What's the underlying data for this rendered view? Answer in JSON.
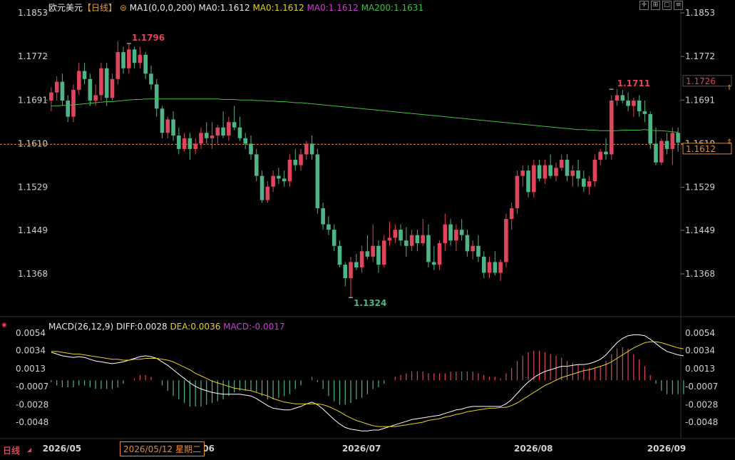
{
  "header": {
    "symbol": "欧元美元",
    "period": "【日线】",
    "ma1_label": "MA1(0,0,0,200)",
    "ma0_white": "MA0:1.1612",
    "ma0_yellow": "MA0:1.1612",
    "ma0_magenta": "MA0:1.1612",
    "ma200": "MA200:1.1631"
  },
  "macd_header": {
    "title": "MACD(26,12,9)",
    "diff": "DIFF:0.0028",
    "dea": "DEA:0.0036",
    "macd": "MACD:-0.0017"
  },
  "colors": {
    "up": "#e0455c",
    "down": "#4fb487",
    "ma200": "#3fbf3f",
    "diff": "#ffffff",
    "dea": "#e6d21e",
    "macd_label": "#c93fd0",
    "price_line": "#e08a3a",
    "grid": "#2a2a2a"
  },
  "bottom_bar": {
    "period_tab": "日线",
    "date_box": "2026/05/12 星期二"
  },
  "chart_data": [
    {
      "type": "candlestick",
      "title": "欧元美元",
      "y_ticks": [
        "1.1853",
        "1.1772",
        "1.1691",
        "1.1610",
        "1.1529",
        "1.1449",
        "1.1368"
      ],
      "ylim": [
        1.1287,
        1.1853
      ],
      "x_ticks": [
        "2026/05",
        "2026/06",
        "2026/07",
        "2026/08",
        "2026/09"
      ],
      "annotations": {
        "high": "1.1796",
        "low": "1.1324",
        "recent_high": "1.1711"
      },
      "last_price": "1.1612",
      "right_box_price": "1.1726",
      "right_edge_label": "1.1610",
      "grid": false,
      "candles": [
        [
          1.169,
          1.1715,
          1.167,
          1.1705
        ],
        [
          1.1705,
          1.1735,
          1.169,
          1.1725
        ],
        [
          1.1725,
          1.174,
          1.168,
          1.169
        ],
        [
          1.169,
          1.17,
          1.165,
          1.166
        ],
        [
          1.166,
          1.172,
          1.165,
          1.171
        ],
        [
          1.171,
          1.176,
          1.17,
          1.1745
        ],
        [
          1.1745,
          1.176,
          1.172,
          1.173
        ],
        [
          1.173,
          1.174,
          1.168,
          1.169
        ],
        [
          1.169,
          1.172,
          1.168,
          1.17
        ],
        [
          1.17,
          1.176,
          1.169,
          1.175
        ],
        [
          1.175,
          1.176,
          1.168,
          1.1695
        ],
        [
          1.1695,
          1.174,
          1.169,
          1.173
        ],
        [
          1.173,
          1.18,
          1.172,
          1.178
        ],
        [
          1.178,
          1.179,
          1.174,
          1.175
        ],
        [
          1.175,
          1.1796,
          1.174,
          1.1785
        ],
        [
          1.1785,
          1.179,
          1.175,
          1.176
        ],
        [
          1.176,
          1.179,
          1.175,
          1.1775
        ],
        [
          1.1775,
          1.178,
          1.173,
          1.174
        ],
        [
          1.174,
          1.1755,
          1.171,
          1.172
        ],
        [
          1.172,
          1.173,
          1.166,
          1.1675
        ],
        [
          1.1675,
          1.168,
          1.162,
          1.163
        ],
        [
          1.163,
          1.166,
          1.162,
          1.1655
        ],
        [
          1.1655,
          1.167,
          1.1615,
          1.1625
        ],
        [
          1.1625,
          1.164,
          1.159,
          1.16
        ],
        [
          1.16,
          1.163,
          1.1595,
          1.162
        ],
        [
          1.162,
          1.163,
          1.158,
          1.16
        ],
        [
          1.16,
          1.162,
          1.159,
          1.161
        ],
        [
          1.161,
          1.164,
          1.16,
          1.163
        ],
        [
          1.163,
          1.165,
          1.161,
          1.162
        ],
        [
          1.162,
          1.165,
          1.16,
          1.1625
        ],
        [
          1.1625,
          1.1645,
          1.161,
          1.164
        ],
        [
          1.164,
          1.167,
          1.162,
          1.1625
        ],
        [
          1.1625,
          1.166,
          1.1615,
          1.165
        ],
        [
          1.165,
          1.168,
          1.1635,
          1.164
        ],
        [
          1.164,
          1.166,
          1.1615,
          1.162
        ],
        [
          1.162,
          1.163,
          1.16,
          1.161
        ],
        [
          1.161,
          1.1625,
          1.158,
          1.159
        ],
        [
          1.159,
          1.16,
          1.154,
          1.155
        ],
        [
          1.155,
          1.156,
          1.15,
          1.1505
        ],
        [
          1.1505,
          1.154,
          1.15,
          1.153
        ],
        [
          1.153,
          1.156,
          1.152,
          1.155
        ],
        [
          1.155,
          1.1565,
          1.1535,
          1.1545
        ],
        [
          1.1545,
          1.156,
          1.153,
          1.154
        ],
        [
          1.154,
          1.159,
          1.153,
          1.158
        ],
        [
          1.158,
          1.16,
          1.156,
          1.157
        ],
        [
          1.157,
          1.16,
          1.156,
          1.159
        ],
        [
          1.159,
          1.1615,
          1.158,
          1.161
        ],
        [
          1.161,
          1.1625,
          1.158,
          1.159
        ],
        [
          1.159,
          1.16,
          1.148,
          1.149
        ],
        [
          1.149,
          1.15,
          1.145,
          1.146
        ],
        [
          1.146,
          1.1475,
          1.144,
          1.145
        ],
        [
          1.145,
          1.146,
          1.141,
          1.142
        ],
        [
          1.142,
          1.143,
          1.138,
          1.1385
        ],
        [
          1.1385,
          1.139,
          1.1345,
          1.136
        ],
        [
          1.136,
          1.14,
          1.1324,
          1.139
        ],
        [
          1.139,
          1.1405,
          1.1375,
          1.138
        ],
        [
          1.138,
          1.142,
          1.137,
          1.141
        ],
        [
          1.141,
          1.144,
          1.1395,
          1.14
        ],
        [
          1.14,
          1.146,
          1.139,
          1.142
        ],
        [
          1.142,
          1.143,
          1.137,
          1.1385
        ],
        [
          1.1385,
          1.144,
          1.138,
          1.143
        ],
        [
          1.143,
          1.1465,
          1.142,
          1.1435
        ],
        [
          1.1435,
          1.146,
          1.1425,
          1.145
        ],
        [
          1.145,
          1.146,
          1.142,
          1.143
        ],
        [
          1.143,
          1.1455,
          1.14,
          1.142
        ],
        [
          1.142,
          1.145,
          1.141,
          1.144
        ],
        [
          1.144,
          1.145,
          1.141,
          1.1425
        ],
        [
          1.1425,
          1.147,
          1.142,
          1.144
        ],
        [
          1.144,
          1.146,
          1.138,
          1.139
        ],
        [
          1.139,
          1.142,
          1.1375,
          1.1385
        ],
        [
          1.1385,
          1.143,
          1.1375,
          1.1425
        ],
        [
          1.1425,
          1.148,
          1.141,
          1.146
        ],
        [
          1.146,
          1.147,
          1.142,
          1.143
        ],
        [
          1.143,
          1.146,
          1.141,
          1.145
        ],
        [
          1.145,
          1.147,
          1.143,
          1.144
        ],
        [
          1.144,
          1.145,
          1.14,
          1.141
        ],
        [
          1.141,
          1.143,
          1.1395,
          1.142
        ],
        [
          1.142,
          1.144,
          1.139,
          1.14
        ],
        [
          1.14,
          1.141,
          1.136,
          1.137
        ],
        [
          1.137,
          1.14,
          1.136,
          1.139
        ],
        [
          1.139,
          1.141,
          1.1365,
          1.137
        ],
        [
          1.137,
          1.1395,
          1.1355,
          1.139
        ],
        [
          1.139,
          1.148,
          1.138,
          1.147
        ],
        [
          1.147,
          1.15,
          1.145,
          1.149
        ],
        [
          1.149,
          1.156,
          1.148,
          1.155
        ],
        [
          1.155,
          1.157,
          1.153,
          1.156
        ],
        [
          1.156,
          1.157,
          1.151,
          1.152
        ],
        [
          1.152,
          1.158,
          1.151,
          1.157
        ],
        [
          1.157,
          1.158,
          1.154,
          1.1545
        ],
        [
          1.1545,
          1.158,
          1.1535,
          1.157
        ],
        [
          1.157,
          1.159,
          1.1545,
          1.155
        ],
        [
          1.155,
          1.1575,
          1.154,
          1.1565
        ],
        [
          1.1565,
          1.159,
          1.156,
          1.158
        ],
        [
          1.158,
          1.159,
          1.154,
          1.155
        ],
        [
          1.155,
          1.157,
          1.153,
          1.156
        ],
        [
          1.156,
          1.158,
          1.153,
          1.1545
        ],
        [
          1.1545,
          1.156,
          1.152,
          1.153
        ],
        [
          1.153,
          1.155,
          1.1515,
          1.154
        ],
        [
          1.154,
          1.159,
          1.153,
          1.158
        ],
        [
          1.158,
          1.16,
          1.157,
          1.1595
        ],
        [
          1.1595,
          1.162,
          1.158,
          1.159
        ],
        [
          1.159,
          1.17,
          1.158,
          1.169
        ],
        [
          1.169,
          1.1711,
          1.168,
          1.17
        ],
        [
          1.17,
          1.171,
          1.1685,
          1.169
        ],
        [
          1.169,
          1.1705,
          1.167,
          1.168
        ],
        [
          1.168,
          1.1695,
          1.166,
          1.169
        ],
        [
          1.169,
          1.17,
          1.166,
          1.167
        ],
        [
          1.167,
          1.169,
          1.165,
          1.1665
        ],
        [
          1.1665,
          1.167,
          1.16,
          1.161
        ],
        [
          1.161,
          1.164,
          1.157,
          1.1575
        ],
        [
          1.1575,
          1.162,
          1.157,
          1.1615
        ],
        [
          1.1615,
          1.163,
          1.159,
          1.16
        ],
        [
          1.16,
          1.164,
          1.157,
          1.163
        ],
        [
          1.163,
          1.164,
          1.1595,
          1.1612
        ]
      ],
      "ma200": [
        1.168,
        1.168,
        1.1681,
        1.1681,
        1.1682,
        1.1683,
        1.1684,
        1.1685,
        1.1686,
        1.1687,
        1.1688,
        1.1688,
        1.1689,
        1.169,
        1.1691,
        1.1692,
        1.1692,
        1.1693,
        1.1693,
        1.1693,
        1.1693,
        1.1693,
        1.1693,
        1.1693,
        1.1693,
        1.1693,
        1.1693,
        1.1693,
        1.1693,
        1.1693,
        1.1693,
        1.1692,
        1.1692,
        1.1692,
        1.1691,
        1.1691,
        1.1691,
        1.169,
        1.169,
        1.1689,
        1.1689,
        1.1688,
        1.1688,
        1.1687,
        1.1686,
        1.1686,
        1.1685,
        1.1684,
        1.1683,
        1.1682,
        1.1681,
        1.168,
        1.1679,
        1.1678,
        1.1677,
        1.1676,
        1.1675,
        1.1674,
        1.1673,
        1.1672,
        1.1671,
        1.167,
        1.1669,
        1.1668,
        1.1667,
        1.1666,
        1.1665,
        1.1664,
        1.1663,
        1.1662,
        1.1661,
        1.166,
        1.1659,
        1.1658,
        1.1657,
        1.1656,
        1.1655,
        1.1654,
        1.1653,
        1.1652,
        1.1651,
        1.165,
        1.1649,
        1.1648,
        1.1647,
        1.1646,
        1.1645,
        1.1644,
        1.1643,
        1.1642,
        1.1641,
        1.164,
        1.1639,
        1.1638,
        1.1637,
        1.1636,
        1.1636,
        1.1635,
        1.1635,
        1.1634,
        1.1634,
        1.1634,
        1.1634,
        1.1635,
        1.1635,
        1.1635,
        1.1635,
        1.1636,
        1.1635,
        1.1634,
        1.1634,
        1.1633,
        1.1632,
        1.1631
      ]
    },
    {
      "type": "line",
      "title": "MACD(26,12,9)",
      "y_ticks": [
        "0.0054",
        "0.0034",
        "0.0013",
        "-0.0007",
        "-0.0028",
        "-0.0048"
      ],
      "ylim": [
        -0.0064,
        0.0066
      ],
      "series": [
        {
          "name": "DIFF",
          "values": [
            0.0032,
            0.003,
            0.0028,
            0.0027,
            0.0026,
            0.0027,
            0.0026,
            0.0024,
            0.0022,
            0.0021,
            0.002,
            0.0019,
            0.002,
            0.0021,
            0.0023,
            0.0025,
            0.0027,
            0.0028,
            0.0027,
            0.0025,
            0.0021,
            0.0017,
            0.0012,
            0.0007,
            0.0002,
            -0.0003,
            -0.0007,
            -0.001,
            -0.0012,
            -0.0014,
            -0.0015,
            -0.0016,
            -0.0016,
            -0.0016,
            -0.0016,
            -0.0017,
            -0.0018,
            -0.0021,
            -0.0025,
            -0.0029,
            -0.0032,
            -0.0033,
            -0.0034,
            -0.0034,
            -0.0032,
            -0.003,
            -0.0027,
            -0.0025,
            -0.0028,
            -0.0033,
            -0.0039,
            -0.0045,
            -0.005,
            -0.0054,
            -0.0056,
            -0.0057,
            -0.0058,
            -0.0058,
            -0.0057,
            -0.0057,
            -0.0055,
            -0.0053,
            -0.0051,
            -0.0049,
            -0.0047,
            -0.0045,
            -0.0044,
            -0.0043,
            -0.0042,
            -0.0041,
            -0.004,
            -0.0038,
            -0.0036,
            -0.0034,
            -0.0033,
            -0.0031,
            -0.003,
            -0.003,
            -0.003,
            -0.003,
            -0.003,
            -0.003,
            -0.0027,
            -0.0022,
            -0.0015,
            -0.0008,
            -0.0002,
            0.0003,
            0.0007,
            0.001,
            0.0012,
            0.0014,
            0.0016,
            0.0016,
            0.0017,
            0.0018,
            0.0018,
            0.0019,
            0.0021,
            0.0024,
            0.0029,
            0.0036,
            0.0043,
            0.0048,
            0.0051,
            0.0052,
            0.0052,
            0.0051,
            0.0047,
            0.0042,
            0.0037,
            0.0033,
            0.0031,
            0.0029,
            0.0028
          ]
        },
        {
          "name": "DEA",
          "values": [
            0.0033,
            0.0033,
            0.0032,
            0.0031,
            0.003,
            0.003,
            0.0029,
            0.0028,
            0.0027,
            0.0026,
            0.0025,
            0.0024,
            0.0024,
            0.0023,
            0.0023,
            0.0024,
            0.0024,
            0.0025,
            0.0025,
            0.0025,
            0.0024,
            0.0023,
            0.0021,
            0.0018,
            0.0015,
            0.0012,
            0.0008,
            0.0005,
            0.0002,
            -0.0001,
            -0.0003,
            -0.0005,
            -0.0007,
            -0.0009,
            -0.001,
            -0.0011,
            -0.0012,
            -0.0014,
            -0.0016,
            -0.0018,
            -0.0021,
            -0.0023,
            -0.0025,
            -0.0026,
            -0.0027,
            -0.0027,
            -0.0027,
            -0.0027,
            -0.0027,
            -0.0028,
            -0.003,
            -0.0033,
            -0.0036,
            -0.004,
            -0.0043,
            -0.0046,
            -0.0048,
            -0.005,
            -0.0052,
            -0.0053,
            -0.0053,
            -0.0053,
            -0.0053,
            -0.0052,
            -0.0051,
            -0.005,
            -0.0049,
            -0.0048,
            -0.0046,
            -0.0045,
            -0.0044,
            -0.0042,
            -0.0041,
            -0.0039,
            -0.0038,
            -0.0036,
            -0.0035,
            -0.0034,
            -0.0033,
            -0.0032,
            -0.0032,
            -0.0031,
            -0.0031,
            -0.0029,
            -0.0026,
            -0.0022,
            -0.0018,
            -0.0014,
            -0.001,
            -0.0006,
            -0.0003,
            0.0,
            0.0003,
            0.0005,
            0.0007,
            0.0009,
            0.0011,
            0.0012,
            0.0014,
            0.0016,
            0.0018,
            0.0021,
            0.0025,
            0.0029,
            0.0033,
            0.0037,
            0.004,
            0.0043,
            0.0044,
            0.0044,
            0.0043,
            0.0041,
            0.0039,
            0.0037,
            0.0036
          ]
        }
      ]
    }
  ]
}
